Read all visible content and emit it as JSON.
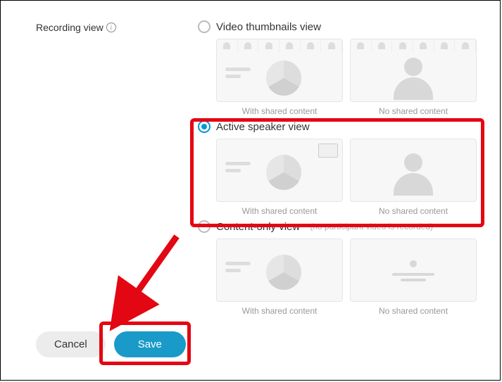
{
  "section_label": "Recording view",
  "options": {
    "video_thumbnails": {
      "title": "Video thumbnails view",
      "preview1_caption": "With shared content",
      "preview2_caption": "No shared content",
      "selected": false
    },
    "active_speaker": {
      "title": "Active speaker view",
      "preview1_caption": "With shared content",
      "preview2_caption": "No shared content",
      "selected": true
    },
    "content_only": {
      "title": "Content-only view",
      "hint": "(no participant video is recorded)",
      "preview1_caption": "With shared content",
      "preview2_caption": "No shared content",
      "selected": false
    }
  },
  "buttons": {
    "cancel": "Cancel",
    "save": "Save"
  },
  "colors": {
    "accent": "#1a9ac9",
    "highlight": "#e30613"
  }
}
